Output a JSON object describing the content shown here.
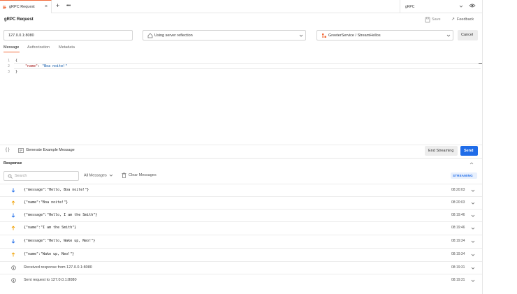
{
  "tab": {
    "label": "gRPC Request"
  },
  "environment": {
    "label": "gRPC"
  },
  "header": {
    "title": "gRPC Request",
    "save_label": "Save",
    "feedback_label": "Feedback"
  },
  "request": {
    "url": "127.0.0.1:8080",
    "reflection": "Using server reflection",
    "method": "GreeterService / StreamHellos",
    "cancel_label": "Cancel"
  },
  "subtabs": [
    "Message",
    "Authorization",
    "Metadata"
  ],
  "editor": {
    "line_numbers": [
      "1",
      "2",
      "3"
    ],
    "open_brace": "{",
    "key": "\"name\"",
    "colon": ": ",
    "value": "\"Boa noite!\"",
    "close_brace": "}"
  },
  "editor_footer": {
    "braces": "{ }",
    "generate_label": "Generate Example Message",
    "end_streaming_label": "End Streaming",
    "send_label": "Send"
  },
  "response": {
    "title": "Response",
    "search_placeholder": "Search",
    "filter_label": "All Messages",
    "clear_label": "Clear Messages",
    "streaming_badge": "STREAMING",
    "rows": [
      {
        "direction": "received",
        "text": "{\"message\":\"Hello, Boa noite!\"}",
        "time": "08:20:03"
      },
      {
        "direction": "sent",
        "text": "{\"name\":\"Boa noite!\"}",
        "time": "08:20:03"
      },
      {
        "direction": "received",
        "text": "{\"message\":\"Hello, I am the Smith\"}",
        "time": "08:19:46"
      },
      {
        "direction": "sent",
        "text": "{\"name\":\"I am the Smith\"}",
        "time": "08:19:46"
      },
      {
        "direction": "received",
        "text": "{\"message\":\"Hello, Wake up, Neo!\"}",
        "time": "08:19:34"
      },
      {
        "direction": "sent",
        "text": "{\"name\":\"Wake up, Neo!\"}",
        "time": "08:19:34"
      },
      {
        "direction": "info",
        "text": "Received response from 127.0.0.1:8080",
        "time": "08:19:31"
      },
      {
        "direction": "info",
        "text": "Sent request to 127.0.0.1:8080",
        "time": "08:19:31"
      }
    ]
  },
  "colors": {
    "accent": "#f26b3a",
    "send": "#1f6ce8",
    "received_arrow": "#1f6ce8",
    "sent_arrow": "#f0a000"
  }
}
